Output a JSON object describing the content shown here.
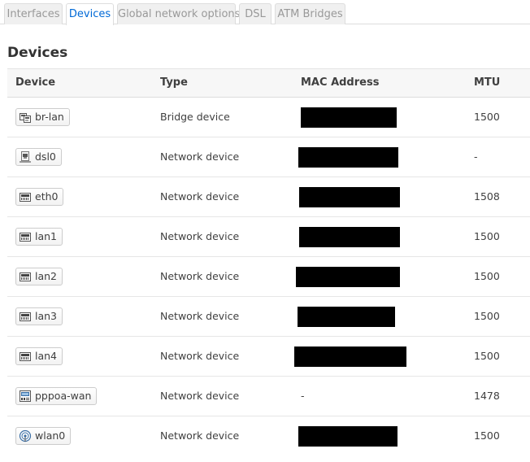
{
  "tabs": [
    {
      "label": "Interfaces",
      "active": false
    },
    {
      "label": "Devices",
      "active": true
    },
    {
      "label": "Global network options",
      "active": false
    },
    {
      "label": "DSL",
      "active": false
    },
    {
      "label": "ATM Bridges",
      "active": false
    }
  ],
  "section": {
    "title": "Devices"
  },
  "table": {
    "headers": {
      "device": "Device",
      "type": "Type",
      "mac": "MAC Address",
      "mtu": "MTU"
    },
    "rows": [
      {
        "device": "br-lan",
        "icon": "bridge-icon",
        "type": "Bridge device",
        "mac": "",
        "mac_redacted": true,
        "mtu": "1500"
      },
      {
        "device": "dsl0",
        "icon": "dsl-port-icon",
        "type": "Network device",
        "mac": "",
        "mac_redacted": true,
        "mtu": "-"
      },
      {
        "device": "eth0",
        "icon": "ethernet-port-icon",
        "type": "Network device",
        "mac": "",
        "mac_redacted": true,
        "mtu": "1508"
      },
      {
        "device": "lan1",
        "icon": "ethernet-port-icon",
        "type": "Network device",
        "mac": "",
        "mac_redacted": true,
        "mtu": "1500"
      },
      {
        "device": "lan2",
        "icon": "ethernet-port-icon",
        "type": "Network device",
        "mac": "",
        "mac_redacted": true,
        "mtu": "1500"
      },
      {
        "device": "lan3",
        "icon": "ethernet-port-icon",
        "type": "Network device",
        "mac": "",
        "mac_redacted": true,
        "mtu": "1500"
      },
      {
        "device": "lan4",
        "icon": "ethernet-port-icon",
        "type": "Network device",
        "mac": "",
        "mac_redacted": true,
        "mtu": "1500"
      },
      {
        "device": "pppoa-wan",
        "icon": "tunnel-icon",
        "type": "Network device",
        "mac": "-",
        "mac_redacted": false,
        "mtu": "1478"
      },
      {
        "device": "wlan0",
        "icon": "wifi-icon",
        "type": "Network device",
        "mac": "",
        "mac_redacted": true,
        "mtu": "1500"
      }
    ]
  },
  "colors": {
    "active_tab_text": "#0069d6",
    "inactive_tab_text": "#999999",
    "redaction": "#000000"
  }
}
